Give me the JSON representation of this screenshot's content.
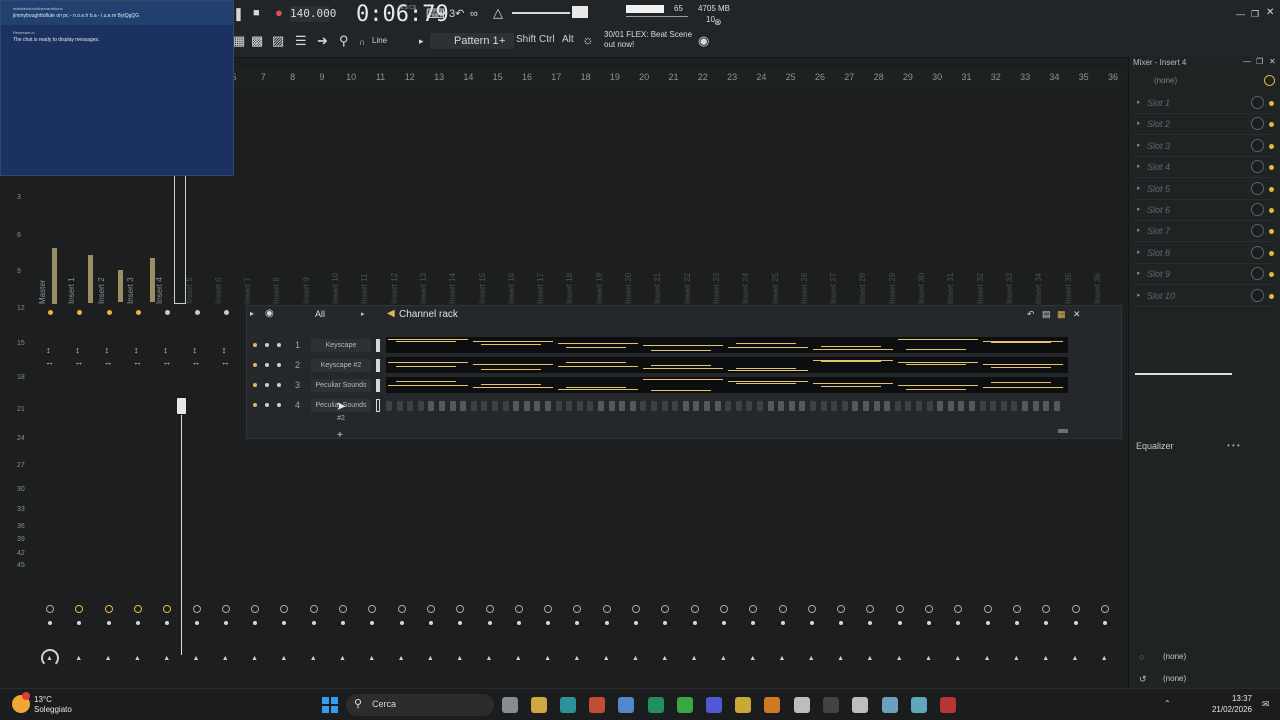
{
  "toolbar": {
    "tempo": "140.000",
    "time": "0:06:79",
    "time_unit": "M:S:CS",
    "pattern_label": "Pattern 1",
    "mode_label": "Line",
    "modifiers": [
      "Shift",
      "Ctrl",
      "Alt"
    ],
    "hint_line1": "30/01  FLEX: Beat Scene",
    "hint_line2": "out now!",
    "cpu_value": "65",
    "ram": "4705 MB",
    "polyphony": "10",
    "icons": [
      "pause-icon",
      "stop-icon",
      "record-icon",
      "typing-keyboard-icon",
      "countdown-icon",
      "wait-icon",
      "metronome-icon"
    ]
  },
  "chat_overlay": {
    "line1": "mattdavidoviolinsmarathons",
    "line2": "jimmyboughttoflute on pc - n.o.e.h b.a - i.u.e.m BytQgQG",
    "line3": "Restream.io",
    "line4": "The chat is ready to display messages."
  },
  "ruler": {
    "bars": [
      "6",
      "7",
      "8",
      "9",
      "10",
      "11",
      "12",
      "13",
      "14",
      "15",
      "16",
      "17",
      "18",
      "19",
      "20",
      "21",
      "22",
      "23",
      "24",
      "25",
      "26",
      "27",
      "28",
      "29",
      "30",
      "31",
      "32",
      "33",
      "34",
      "35",
      "36"
    ]
  },
  "mixer": {
    "db_scale": [
      "3",
      "6",
      "9",
      "12",
      "15",
      "18",
      "21",
      "24",
      "27",
      "30",
      "33",
      "36",
      "39",
      "42",
      "45"
    ],
    "tracks": [
      "Master",
      "Insert 1",
      "Insert 2",
      "Insert 3",
      "Insert 4",
      "Insert 5",
      "Insert 6",
      "Insert 7",
      "Insert 8",
      "Insert 9",
      "Insert 10",
      "Insert 11",
      "Insert 12",
      "Insert 13",
      "Insert 14",
      "Insert 15",
      "Insert 16",
      "Insert 17",
      "Insert 18",
      "Insert 19",
      "Insert 20",
      "Insert 21",
      "Insert 22",
      "Insert 23",
      "Insert 24",
      "Insert 25",
      "Insert 26",
      "Insert 27",
      "Insert 28",
      "Insert 29",
      "Insert 30",
      "Insert 31",
      "Insert 32",
      "Insert 33",
      "Insert 34",
      "Insert 35",
      "Insert 36"
    ]
  },
  "channel_rack": {
    "title": "Channel rack",
    "filter": "All",
    "channels": [
      {
        "num": "1",
        "name": "Keyscape"
      },
      {
        "num": "2",
        "name": "Keyscape #2"
      },
      {
        "num": "3",
        "name": "Peculiar Sounds"
      },
      {
        "num": "4",
        "name": "Peculiar Sounds #2"
      }
    ],
    "accent_color": "#e4c36e"
  },
  "mixer_panel": {
    "header": "Mixer - Insert 4",
    "input": "(none)",
    "slots": [
      "Slot 1",
      "Slot 2",
      "Slot 3",
      "Slot 4",
      "Slot 5",
      "Slot 6",
      "Slot 7",
      "Slot 8",
      "Slot 9",
      "Slot 10"
    ],
    "equalizer": "Equalizer",
    "output1": "(none)",
    "output2": "(none)"
  },
  "taskbar": {
    "temperature": "13°C",
    "condition": "Soleggiato",
    "search_placeholder": "Cerca",
    "time": "13:37",
    "date": "21/02/2026",
    "apps": [
      "windows-start-icon",
      "task-view-icon",
      "file-explorer-icon",
      "edge-icon",
      "brave-icon",
      "chrome-icon",
      "app-green-icon",
      "app-green2-icon",
      "discord-icon",
      "app-yellow-icon",
      "fl-studio-icon",
      "ableton-live-icon",
      "app-a-icon",
      "app-id-icon",
      "app-circle-icon",
      "app-headphones-icon",
      "app-red-icon"
    ]
  }
}
